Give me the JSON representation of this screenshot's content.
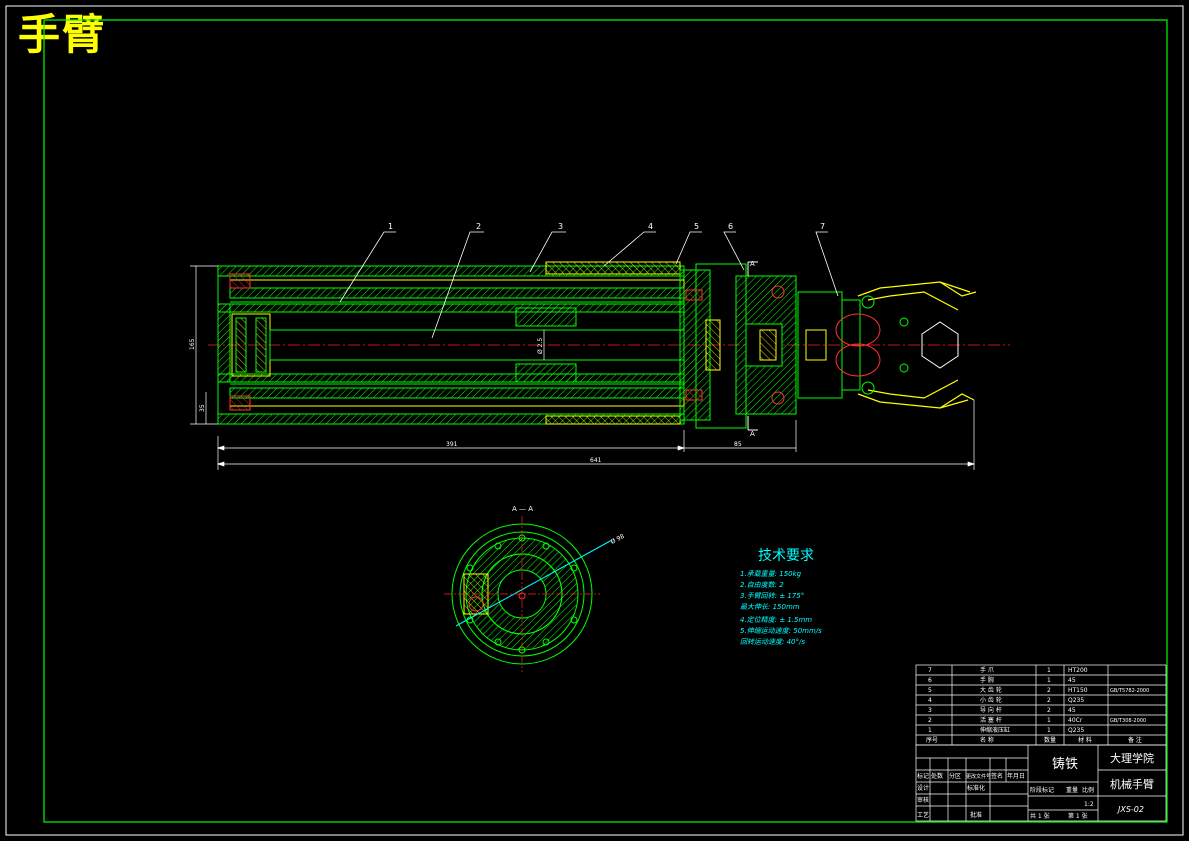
{
  "sheet_title": "手臂",
  "section_label": "A — A",
  "part_callouts": [
    "1",
    "2",
    "3",
    "4",
    "5",
    "6",
    "7"
  ],
  "section_marks": [
    "A",
    "A"
  ],
  "dimensions": {
    "d1": "391",
    "d2": "85",
    "d_total": "641",
    "d_left_height": "165",
    "d_left_small": "35",
    "d_bore": "Ø 2.5",
    "d_section": "Ø 98"
  },
  "tech_req": {
    "heading": "技术要求",
    "items": [
      "1.承载重量: 150kg",
      "2.自由度数: 2",
      "3.手臂回转: ± 175°",
      "   最大伸长: 150mm",
      "4.定位精度: ± 1.5mm",
      "5.伸缩运动速度: 50mm/s",
      "   回转运动速度: 40°/s"
    ]
  },
  "bom": {
    "rows": [
      {
        "no": "7",
        "name": "手 爪",
        "qty": "1",
        "material": "HT200",
        "std": ""
      },
      {
        "no": "6",
        "name": "手 腕",
        "qty": "1",
        "material": "45",
        "std": ""
      },
      {
        "no": "5",
        "name": "大 齿 轮",
        "qty": "2",
        "material": "HT150",
        "std": "GB/T5782-2000"
      },
      {
        "no": "4",
        "name": "小 齿 轮",
        "qty": "2",
        "material": "Q235",
        "std": ""
      },
      {
        "no": "3",
        "name": "导 向 杆",
        "qty": "2",
        "material": "45",
        "std": ""
      },
      {
        "no": "2",
        "name": "活 塞 杆",
        "qty": "1",
        "material": "40Cr",
        "std": "GB/T308-2000"
      },
      {
        "no": "1",
        "name": "伸缩液压缸",
        "qty": "1",
        "material": "Q235",
        "std": ""
      }
    ],
    "header": [
      "序号",
      "名 称",
      "数量",
      "材 料",
      "备 注"
    ]
  },
  "title_block": {
    "material": "铸铁",
    "school": "大理学院",
    "drawing_name": "机械手臂",
    "drawing_code": "JXS-02",
    "scale": "1:2",
    "labels": {
      "mark": "标记",
      "count": "处数",
      "zone": "分区",
      "change_no": "更改文件号",
      "sign": "签名",
      "date": "年月日",
      "design": "设计",
      "standard": "标准化",
      "check": "审核",
      "process": "工艺",
      "approve": "批准",
      "stage_mark": "阶段标记",
      "weight": "重量",
      "ratio": "比例",
      "sheets": "共 1 张",
      "sheet_no": "第 1 张"
    }
  },
  "colors": {
    "frame": "#00ff00",
    "outline": "#00ff00",
    "highlight": "#ffff00",
    "center": "#ff2020",
    "text": "#ffffff",
    "dim": "#ffffff",
    "cyan": "#00ffff",
    "purple": "#d080ff"
  }
}
